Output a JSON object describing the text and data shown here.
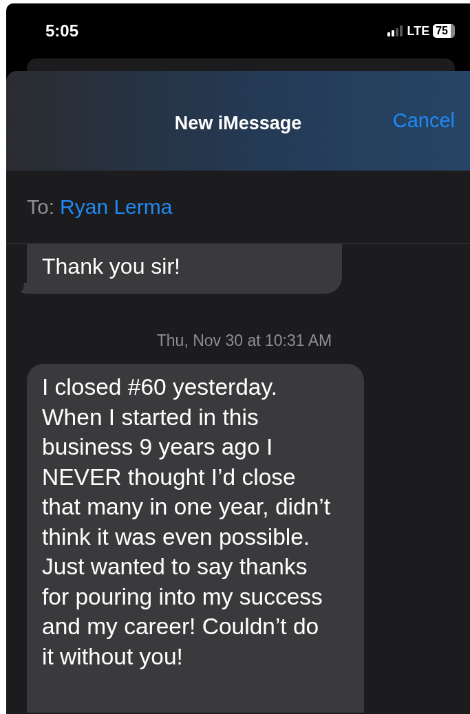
{
  "status_bar": {
    "time": "5:05",
    "network": "LTE",
    "battery": "75"
  },
  "header": {
    "title": "New iMessage",
    "cancel": "Cancel"
  },
  "to": {
    "label": "To:",
    "recipient": "Ryan Lerma"
  },
  "messages": [
    {
      "kind": "bubble",
      "text": "Thank you sir!",
      "tail": true
    },
    {
      "kind": "timestamp",
      "text": "Thu, Nov 30 at 10:31 AM"
    },
    {
      "kind": "bubble",
      "text": "I closed #60 yesterday. When I started in this business 9 years ago I NEVER thought I’d close that many in one year, didn’t think it was even possible. Just wanted to say thanks for pouring into my success and my career! Couldn’t do it without you!",
      "tail": false
    }
  ]
}
